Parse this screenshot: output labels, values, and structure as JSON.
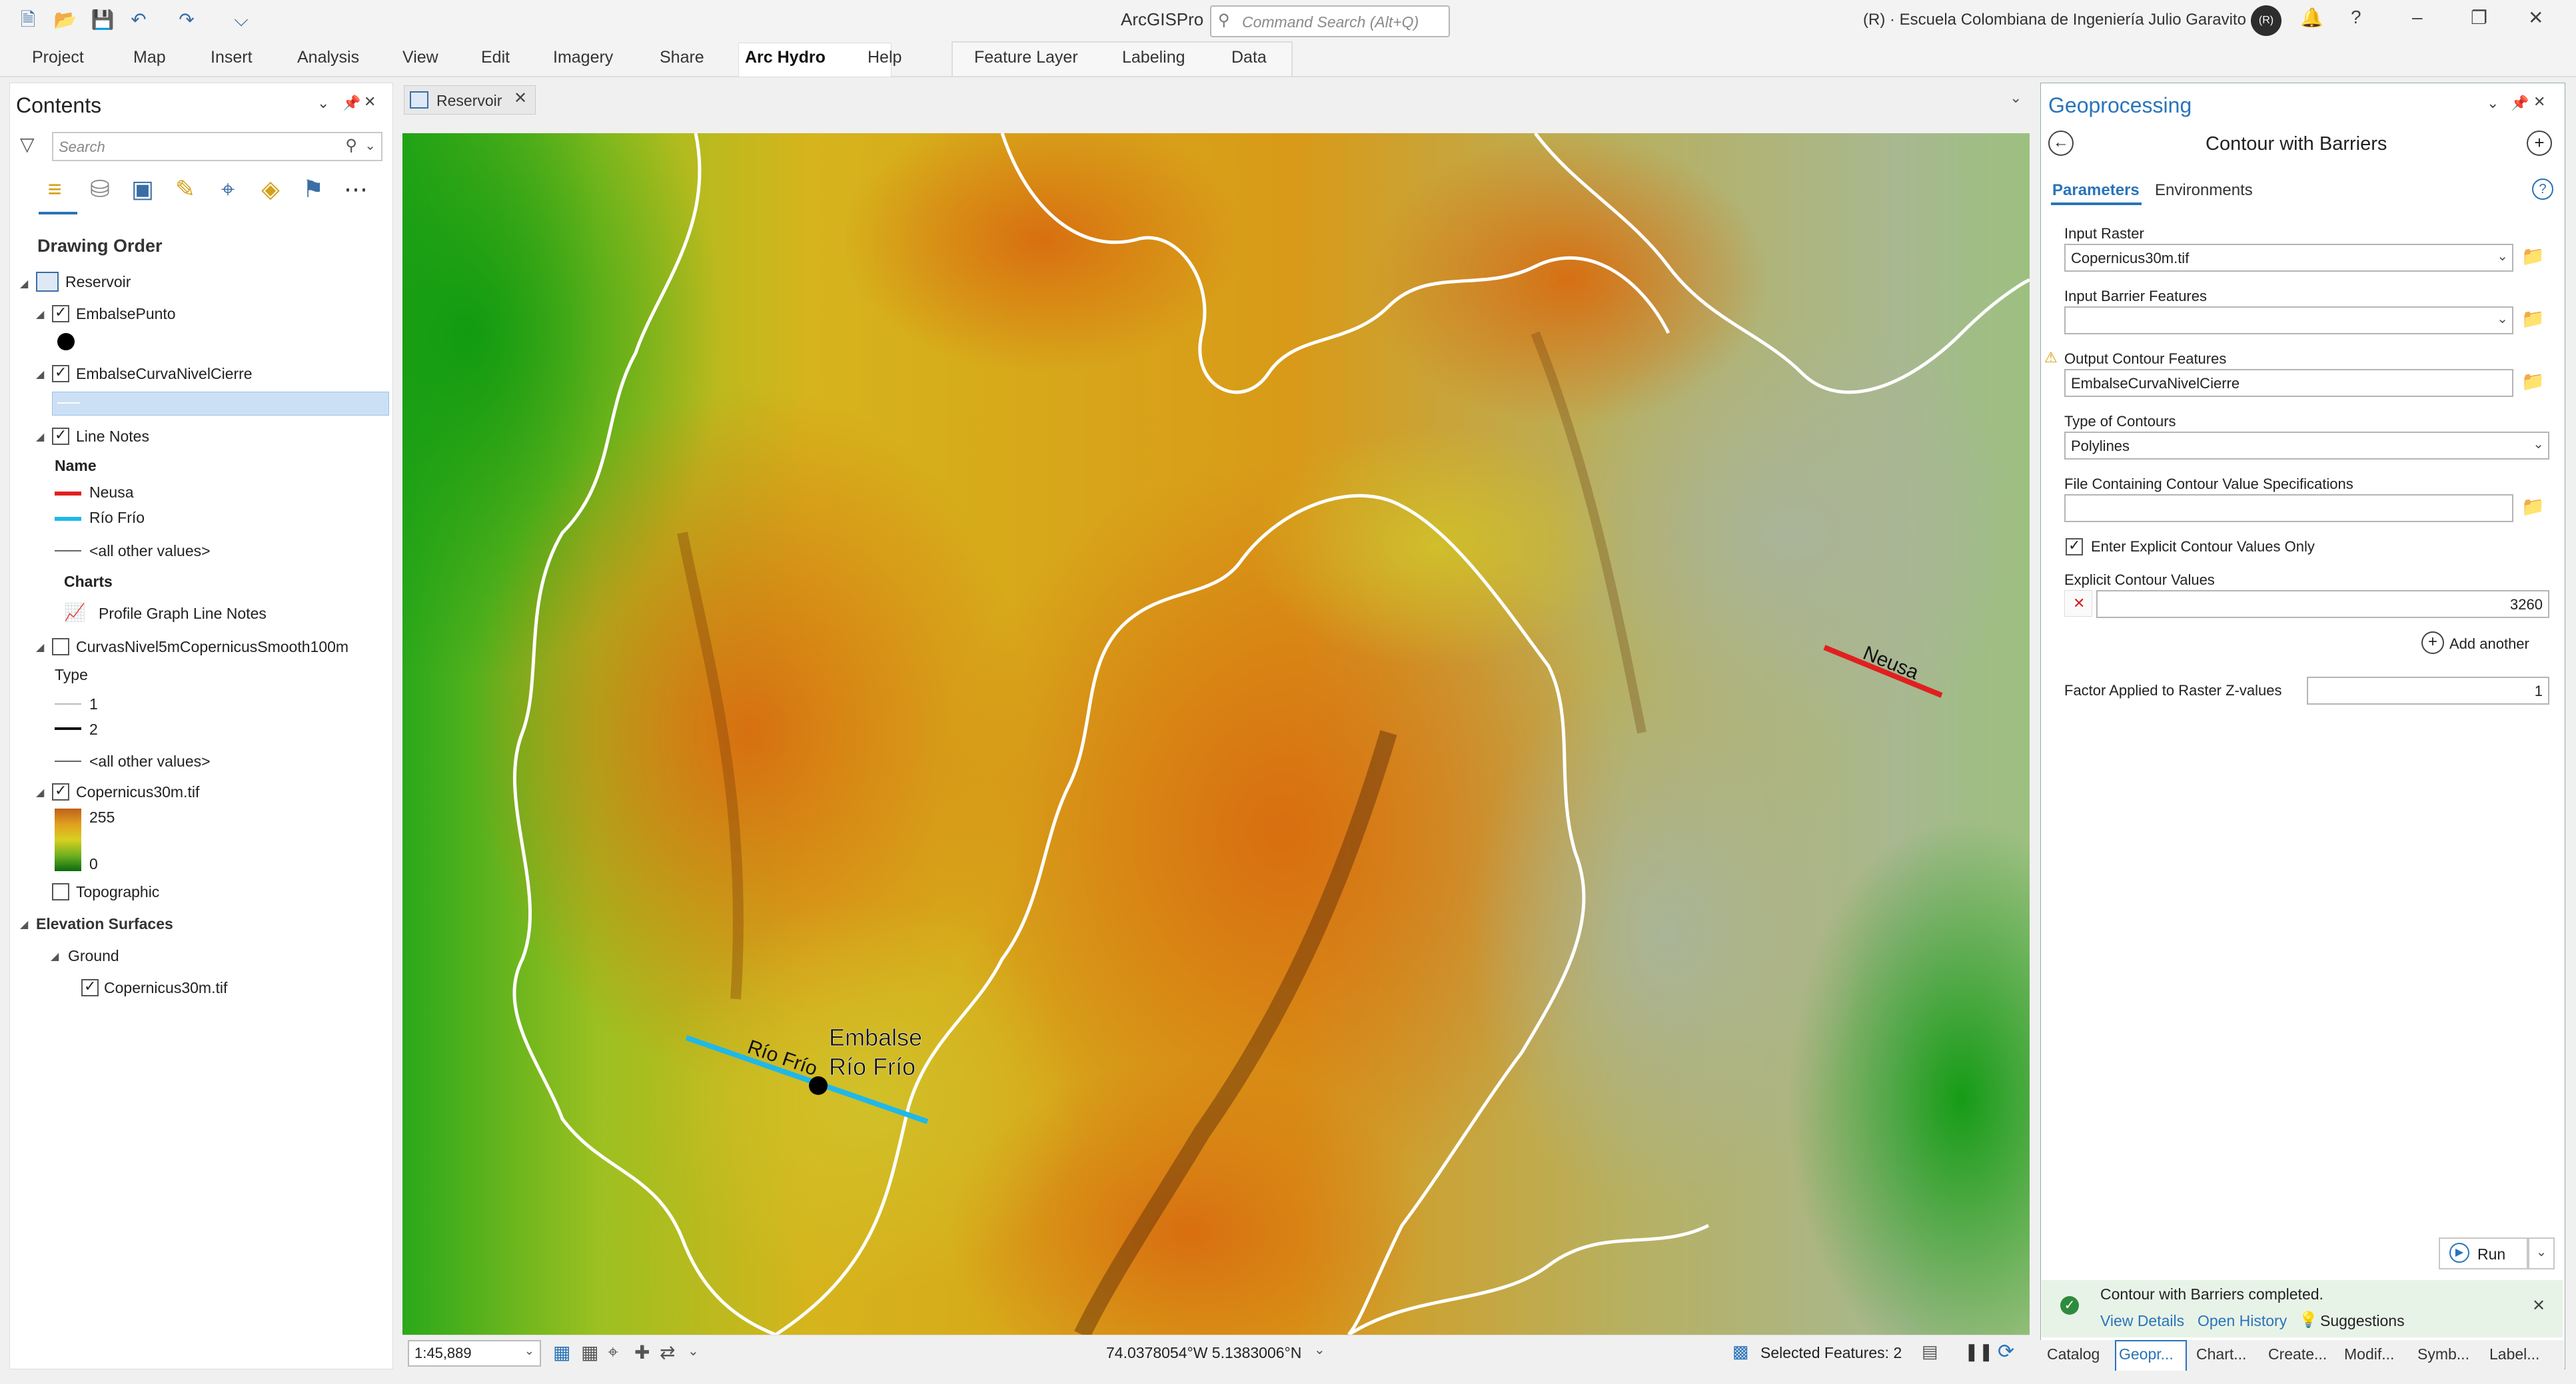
{
  "app": {
    "title": "ArcGISPro",
    "org": "(R) · Escuela Colombiana de Ingeniería Julio Garavito",
    "avatar": "(R)"
  },
  "command_search": {
    "placeholder": "Command Search (Alt+Q)"
  },
  "ribbon": {
    "tabs": [
      "Project",
      "Map",
      "Insert",
      "Analysis",
      "View",
      "Edit",
      "Imagery",
      "Share",
      "Arc Hydro",
      "Help"
    ],
    "active_tab": "Arc Hydro",
    "context_tabs": [
      "Feature Layer",
      "Labeling",
      "Data"
    ]
  },
  "contents": {
    "title": "Contents",
    "search_placeholder": "Search",
    "drawing_order": "Drawing Order",
    "map_name": "Reservoir",
    "layers": {
      "l1": "EmbalsePunto",
      "l2": "EmbalseCurvaNivelCierre",
      "l3": "Line Notes",
      "l3_field": "Name",
      "l3_v1": "Neusa",
      "l3_v2": "Río Frío",
      "l3_other": "<all other values>",
      "l3_charts": "Charts",
      "l3_chart1": "Profile Graph Line Notes",
      "l4": "CurvasNivel5mCopernicusSmooth100m",
      "l4_field": "Type",
      "l4_v1": "1",
      "l4_v2": "2",
      "l4_other": "<all other values>",
      "l5": "Copernicus30m.tif",
      "l5_high": "255",
      "l5_low": "0",
      "l6": "Topographic",
      "elev": "Elevation Surfaces",
      "ground": "Ground",
      "ground_item": "Copernicus30m.tif"
    }
  },
  "map": {
    "tab_label": "Reservoir",
    "labels": {
      "neusa": "Neusa",
      "riofrio": "Río Frío",
      "embalse_1": "Embalse",
      "embalse_2": "Río Frío"
    },
    "scale": "1:45,889",
    "coords": "74.0378054°W 5.1383006°N",
    "selected": "Selected Features: 2"
  },
  "geoprocessing": {
    "title": "Geoprocessing",
    "tool": "Contour with Barriers",
    "tabs": [
      "Parameters",
      "Environments"
    ],
    "params": {
      "input_raster_label": "Input Raster",
      "input_raster_value": "Copernicus30m.tif",
      "barrier_label": "Input Barrier Features",
      "barrier_value": "",
      "output_label": "Output Contour Features",
      "output_value": "EmbalseCurvaNivelCierre",
      "type_label": "Type of Contours",
      "type_value": "Polylines",
      "file_label": "File Containing Contour Value Specifications",
      "explicit_only_label": "Enter Explicit Contour Values Only",
      "explicit_only_checked": true,
      "explicit_values_label": "Explicit Contour Values",
      "explicit_value": "3260",
      "add_another": "Add another",
      "factor_label": "Factor Applied to Raster Z-values",
      "factor_value": "1"
    },
    "run": "Run",
    "message": "Contour with Barriers completed.",
    "links": {
      "details": "View Details",
      "history": "Open History",
      "suggestions": "Suggestions"
    }
  },
  "bottom_tabs": [
    "Catalog",
    "Geopr...",
    "Chart...",
    "Create...",
    "Modif...",
    "Symb...",
    "Label..."
  ],
  "colors": {
    "accent": "#2a74b9",
    "neusa_line": "#e02020",
    "riofrio_line": "#20b8e8"
  }
}
